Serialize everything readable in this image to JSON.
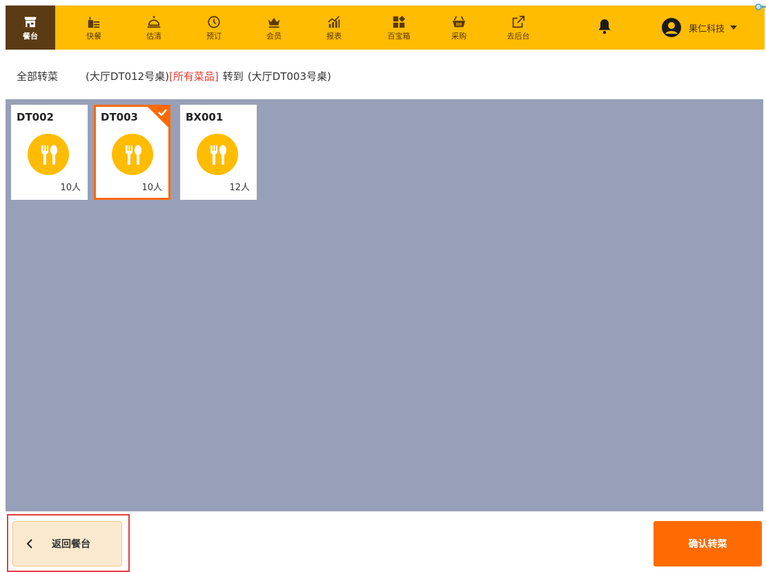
{
  "colors": {
    "topbar": "#ffbc00",
    "active_nav": "#5b3b13",
    "table_area": "#97a0b8",
    "selected": "#ff6a00",
    "confirm": "#ff6b00",
    "highlight_red": "#e23b2e"
  },
  "nav": {
    "items": [
      {
        "label": "餐台",
        "icon": "store-icon"
      },
      {
        "label": "快餐",
        "icon": "fast-food-icon"
      },
      {
        "label": "估清",
        "icon": "cloche-icon"
      },
      {
        "label": "预订",
        "icon": "clock-icon"
      },
      {
        "label": "会员",
        "icon": "crown-icon"
      },
      {
        "label": "报表",
        "icon": "chart-icon"
      },
      {
        "label": "百宝箱",
        "icon": "grid-icon"
      },
      {
        "label": "采购",
        "icon": "basket-icon"
      },
      {
        "label": "去后台",
        "icon": "external-link-icon"
      }
    ],
    "user_name": "果仁科技"
  },
  "transfer": {
    "mode": "全部转菜",
    "from": "(大厅DT012号桌)",
    "items": "[所有菜品]",
    "to_label": "转到",
    "to": "(大厅DT003号桌)"
  },
  "tables": [
    {
      "name": "DT002",
      "capacity": "10人",
      "selected": false
    },
    {
      "name": "DT003",
      "capacity": "10人",
      "selected": true
    },
    {
      "name": "BX001",
      "capacity": "12人",
      "selected": false
    }
  ],
  "footer": {
    "back_label": "返回餐台",
    "confirm_label": "确认转菜"
  }
}
